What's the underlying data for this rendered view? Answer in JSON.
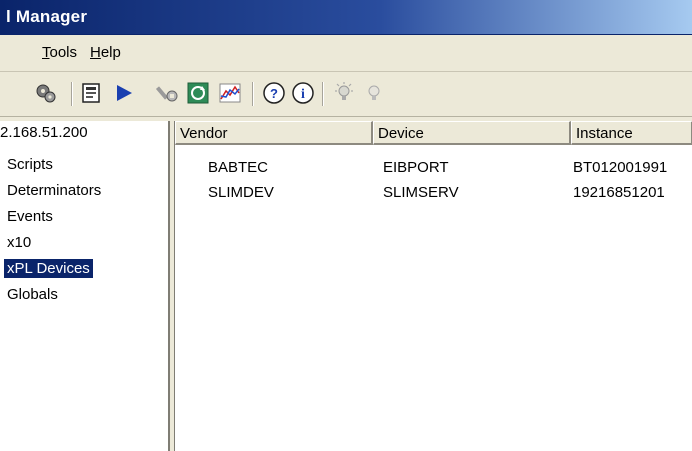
{
  "window": {
    "title": "l Manager"
  },
  "menu": [
    {
      "underline": "T",
      "rest": "ools"
    },
    {
      "underline": "H",
      "rest": "elp"
    }
  ],
  "toolbar": {
    "icons": [
      "gears-icon",
      "properties-icon",
      "play-icon",
      "tools-icon",
      "refresh-icon",
      "chart-icon",
      "help-icon",
      "info-icon",
      "bulb-on-icon",
      "bulb-off-icon"
    ]
  },
  "tree": {
    "root": "2.168.51.200",
    "items": [
      "Scripts",
      "Determinators",
      "Events",
      "x10",
      "xPL Devices",
      "Globals"
    ],
    "selected": "xPL Devices"
  },
  "list": {
    "columns": [
      "Vendor",
      "Device",
      "Instance"
    ],
    "rows": [
      {
        "vendor": "BABTEC",
        "device": "EIBPORT",
        "instance": "BT012001991"
      },
      {
        "vendor": "SLIMDEV",
        "device": "SLIMSERV",
        "instance": "19216851201"
      }
    ]
  },
  "colors": {
    "title_gradient_start": "#0a246a",
    "selection": "#0a246a",
    "chrome": "#ece9d8"
  }
}
